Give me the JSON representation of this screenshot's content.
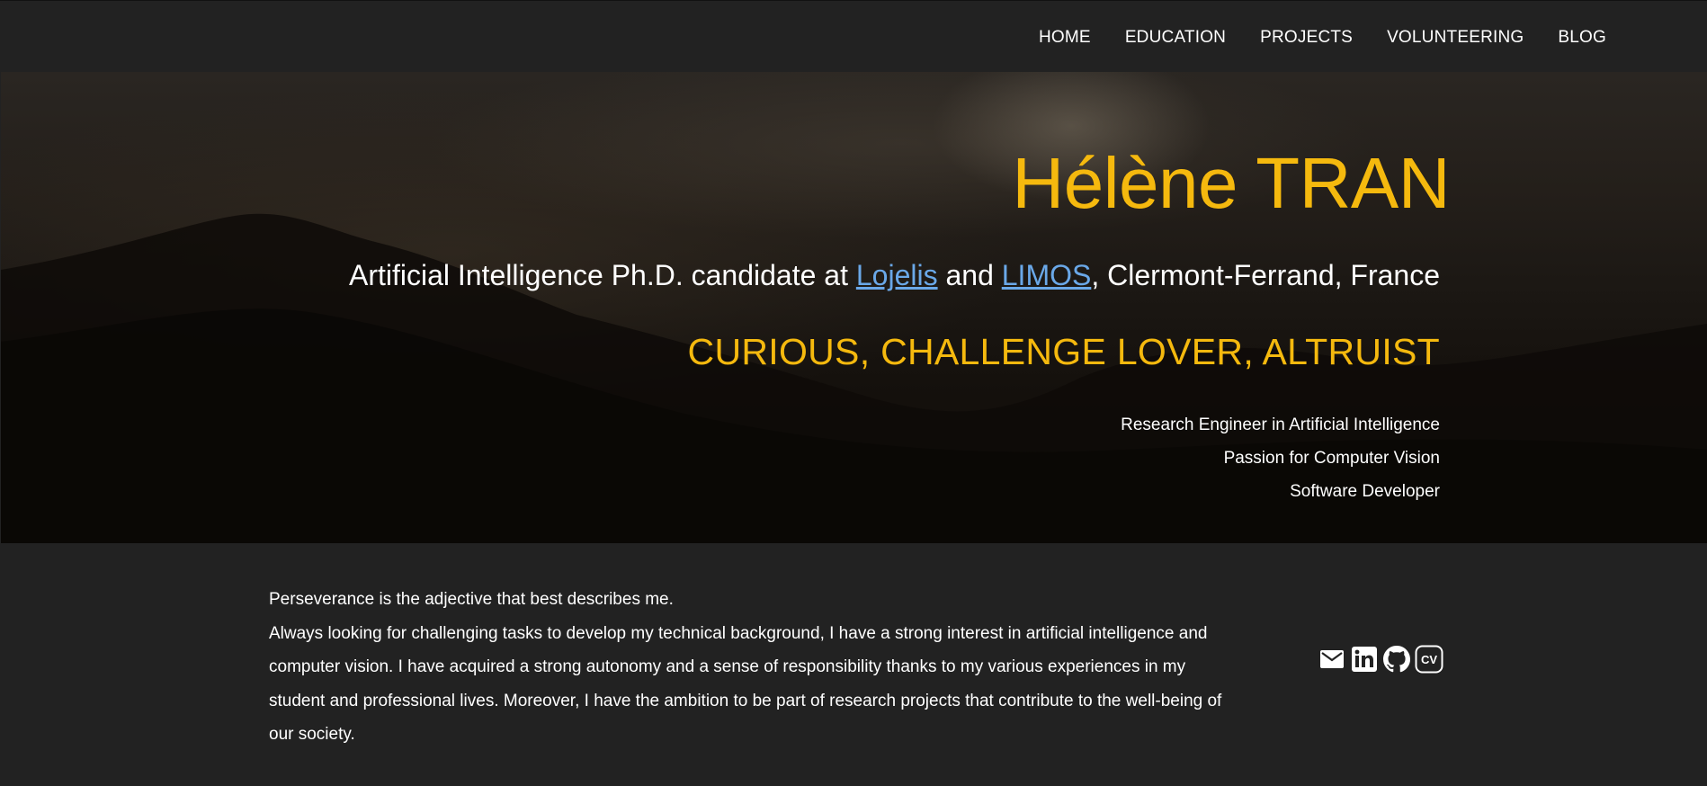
{
  "nav": {
    "items": [
      {
        "label": "HOME"
      },
      {
        "label": "EDUCATION"
      },
      {
        "label": "PROJECTS"
      },
      {
        "label": "VOLUNTEERING"
      },
      {
        "label": "BLOG"
      }
    ]
  },
  "hero": {
    "name": "Hélène TRAN",
    "subtitle_prefix": "Artificial Intelligence Ph.D. candidate at ",
    "link_1": "Lojelis",
    "subtitle_and": " and ",
    "link_2": "LIMOS",
    "subtitle_suffix": ", Clermont-Ferrand, France",
    "tagline": "CURIOUS, CHALLENGE LOVER, ALTRUIST",
    "roles": [
      "Research Engineer in Artificial Intelligence",
      "Passion for Computer Vision",
      "Software Developer"
    ]
  },
  "about": {
    "line_1": "Perseverance is the adjective that best describes me.",
    "paragraph": "Always looking for challenging tasks to develop my technical background, I have a strong interest in artificial intelligence and computer vision. I have acquired a strong autonomy and a sense of responsibility thanks to my various experiences in my student and professional lives. Moreover, I have the ambition to be part of research projects that contribute to the well-being of our society."
  },
  "social": {
    "icons": [
      "mail-icon",
      "linkedin-icon",
      "github-icon",
      "cv-icon"
    ],
    "cv_label": "CV"
  },
  "colors": {
    "accent": "#f5b90e",
    "link": "#6aa8e8",
    "background": "#222222"
  }
}
